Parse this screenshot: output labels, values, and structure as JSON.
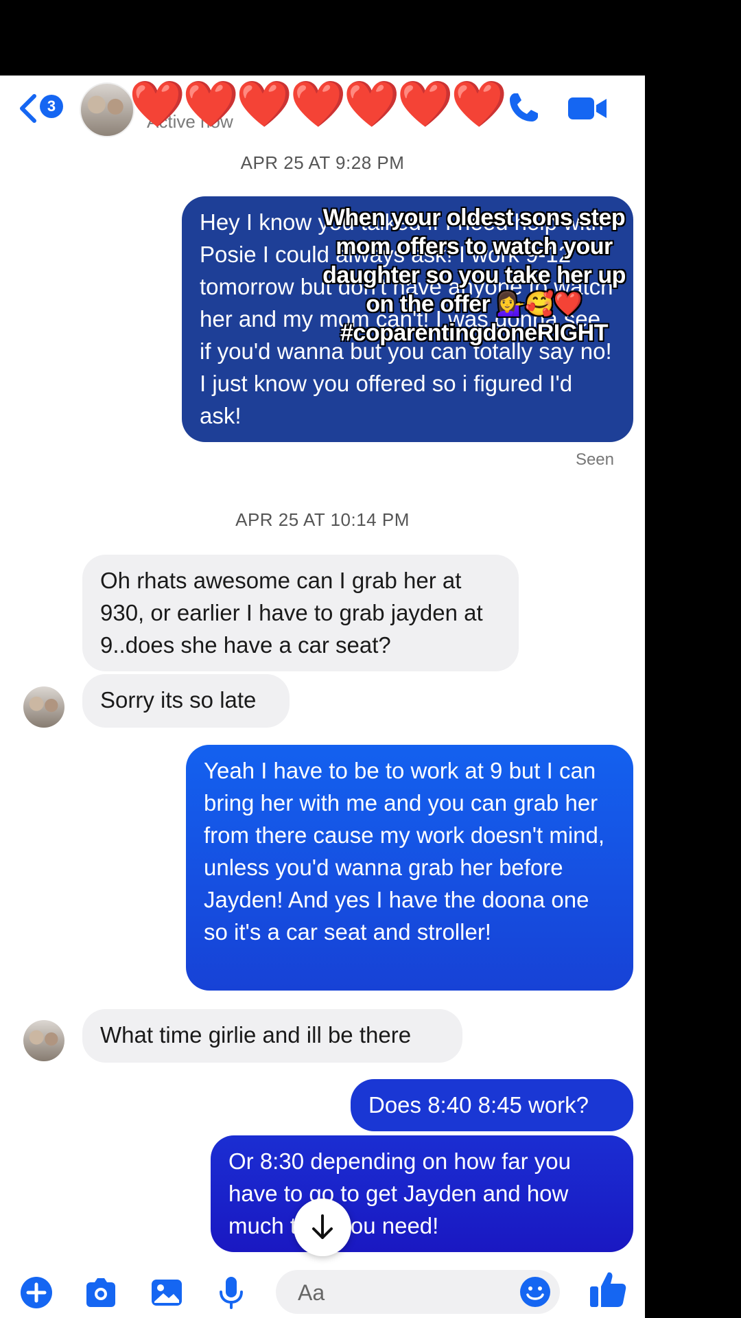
{
  "header": {
    "back_badge": "3",
    "active_status": "Active now",
    "hearts": "❤️❤️❤️❤️❤️❤️❤️"
  },
  "overlay": {
    "caption": "When your oldest sons step mom offers to watch your daughter so you take her up on the offer 💁‍♀️🥰❤️ #coparentingdoneRIGHT"
  },
  "messages": {
    "timestamp_1": "APR 25 AT 9:28 PM",
    "sent_1": "Hey I know you talked if I need help with Posie I could always ask! I work 9-12 tomorrow but don't have anyone to watch her and my mom can't! I was gonna see if you'd wanna but you can totally say no! I just know you offered so i figured I'd ask!",
    "seen": "Seen",
    "timestamp_2": "APR 25 AT 10:14 PM",
    "recv_1": "Oh rhats awesome can I grab her at 930, or earlier I have to grab jayden at 9..does she have a car seat?",
    "recv_2": "Sorry its so late",
    "sent_2": "Yeah I have to be to work at 9 but I can bring her with me and you can grab her from there cause my work doesn't mind, unless you'd wanna grab her before Jayden! And yes I have the doona one so it's a car seat and stroller!",
    "recv_3": "What time girlie and ill be there",
    "sent_3": "Does 8:40 8:45 work?",
    "sent_4": "Or 8:30 depending on how far you have to go to get Jayden and how much time you need!"
  },
  "composer": {
    "placeholder": "Aa"
  },
  "colors": {
    "brand_blue": "#1566f2",
    "sent_top": "#1e3f97",
    "sent_mid": "#0f4bdc",
    "sent_bottom": "#1a18c2",
    "recv_bg": "#f0f0f2"
  }
}
